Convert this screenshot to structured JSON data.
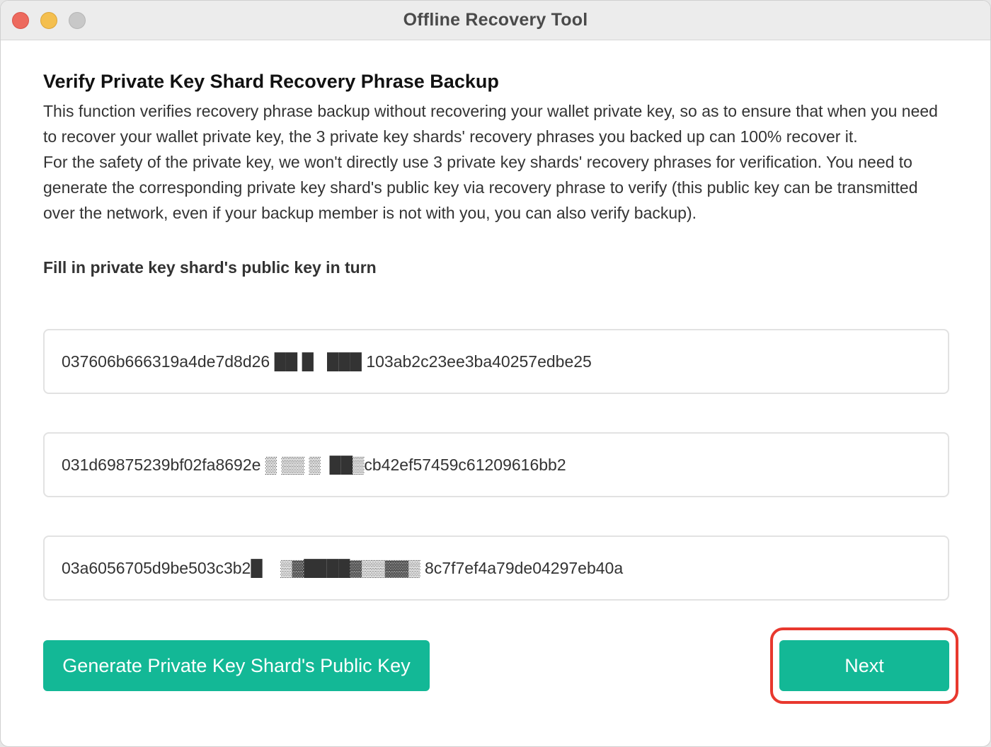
{
  "window": {
    "title": "Offline Recovery Tool",
    "controls": [
      "close",
      "minimize",
      "zoom"
    ]
  },
  "main": {
    "heading": "Verify Private Key Shard Recovery Phrase Backup",
    "paragraphs": [
      "This function verifies recovery phrase backup without recovering your wallet private key, so as to ensure that when you need to recover your wallet private key, the 3 private key shards' recovery phrases you backed up can 100% recover it.",
      "For the safety of the private key, we won't directly use 3 private key shards' recovery phrases for verification. You need to generate the corresponding private key shard's public key via recovery phrase to verify (this public key can be transmitted over the network, even if your backup member is not with you, you can also verify backup)."
    ],
    "field_label": "Fill in private key shard's public key in turn",
    "public_keys": [
      "037606b666319a4de7d8d26 ██ █   ███ 103ab2c23ee3ba40257edbe25",
      "031d69875239bf02fa8692e ▒ ▒▒ ▒  ██▒cb42ef57459c61209616bb2",
      "03a6056705d9be503c3b2█    ▒▓████▓▒▒▓▓▒ 8c7f7ef4a79de04297eb40a"
    ]
  },
  "actions": {
    "generate_label": "Generate Private Key Shard's Public Key",
    "next_label": "Next"
  },
  "colors": {
    "primary": "#13b896",
    "highlight": "#e8382e",
    "titlebar": "#ececec"
  }
}
